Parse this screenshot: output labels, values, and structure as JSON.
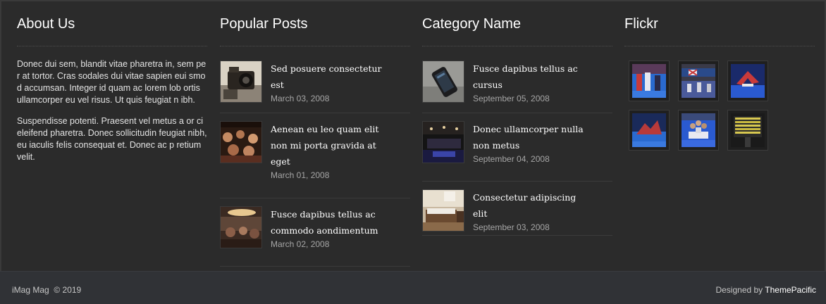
{
  "about": {
    "title": "About Us",
    "paragraphs": [
      "Donec dui sem, blandit vitae pharetra in, sem per at tortor. Cras sodales dui vitae sapien eui smod accumsan. Integer id quam ac lorem lob ortis ullamcorper eu vel risus. Ut quis feugiat n ibh.",
      "Suspendisse potenti. Praesent vel metus a or ci eleifend pharetra. Donec sollicitudin feugiat nibh, eu iaculis felis consequat et. Donec ac p retium velit."
    ]
  },
  "popular": {
    "title": "Popular Posts",
    "posts": [
      {
        "title": "Sed posuere consectetur est",
        "date": "March 03, 2008",
        "thumb": "camera"
      },
      {
        "title": "Aenean eu leo quam elit non mi porta gravida at eget",
        "date": "March 01, 2008",
        "thumb": "crowd"
      },
      {
        "title": "Fusce dapibus tellus ac commodo aondimentum",
        "date": "March 02, 2008",
        "thumb": "room"
      }
    ]
  },
  "category": {
    "title": "Category Name",
    "posts": [
      {
        "title": "Fusce dapibus tellus ac cursus",
        "date": "September 05, 2008",
        "thumb": "phone"
      },
      {
        "title": "Donec ullamcorper nulla non metus",
        "date": "September 04, 2008",
        "thumb": "stage"
      },
      {
        "title": "Consectetur adipiscing elit",
        "date": "September 03, 2008",
        "thumb": "bedroom"
      }
    ]
  },
  "flickr": {
    "title": "Flickr",
    "photos": [
      "gymnastics-1",
      "gymnastics-2",
      "gymnastics-3",
      "gymnastics-4",
      "gymnastics-5",
      "scoreboard"
    ]
  },
  "footer": {
    "copyright": "iMag Mag  © 2019",
    "designed_by_prefix": "Designed by ",
    "designed_by_link": "ThemePacific"
  },
  "colors": {
    "background": "#2b2b2b",
    "footer_bar": "#303236",
    "date": "#a6a6a6"
  }
}
